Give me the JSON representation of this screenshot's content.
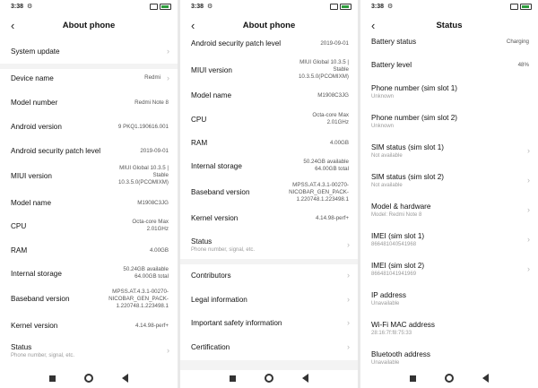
{
  "statusbar": {
    "time": "3:38",
    "gear": "⚙",
    "battery_color": "#2e9c3d"
  },
  "s1": {
    "title": "About phone",
    "items": [
      {
        "label": "System update",
        "value": "",
        "sub": ""
      },
      {
        "label": "Device name",
        "value": "Redmi",
        "sub": ""
      },
      {
        "label": "Model number",
        "value": "Redmi Note 8",
        "sub": ""
      },
      {
        "label": "Android version",
        "value": "9 PKQ1.190616.001",
        "sub": ""
      },
      {
        "label": "Android security patch level",
        "value": "2019-09-01",
        "sub": ""
      },
      {
        "label": "MIUI version",
        "value": "MIUI Global 10.3.5 |\nStable\n10.3.5.0(PCOMIXM)",
        "sub": ""
      },
      {
        "label": "Model name",
        "value": "M1908C3JG",
        "sub": ""
      },
      {
        "label": "CPU",
        "value": "Octa-core Max\n2.01GHz",
        "sub": ""
      },
      {
        "label": "RAM",
        "value": "4.00GB",
        "sub": ""
      },
      {
        "label": "Internal storage",
        "value": "50.24GB available\n64.00GB total",
        "sub": ""
      },
      {
        "label": "Baseband version",
        "value": "MPSS.AT.4.3.1-00270-\nNICOBAR_GEN_PACK-\n1.220748.1.223498.1",
        "sub": ""
      },
      {
        "label": "Kernel version",
        "value": "4.14.98-perf+",
        "sub": ""
      },
      {
        "label": "Status",
        "value": "",
        "sub": "Phone number, signal, etc."
      }
    ]
  },
  "s2": {
    "title": "About phone",
    "items": [
      {
        "label": "Android security patch level",
        "value": "2019-09-01",
        "sub": ""
      },
      {
        "label": "MIUI version",
        "value": "MIUI Global 10.3.5 |\nStable\n10.3.5.0(PCOMIXM)",
        "sub": ""
      },
      {
        "label": "Model name",
        "value": "M1908C3JG",
        "sub": ""
      },
      {
        "label": "CPU",
        "value": "Octa-core Max\n2.01GHz",
        "sub": ""
      },
      {
        "label": "RAM",
        "value": "4.00GB",
        "sub": ""
      },
      {
        "label": "Internal storage",
        "value": "50.24GB available\n64.00GB total",
        "sub": ""
      },
      {
        "label": "Baseband version",
        "value": "MPSS.AT.4.3.1-00270-\nNICOBAR_GEN_PACK-\n1.220748.1.223498.1",
        "sub": ""
      },
      {
        "label": "Kernel version",
        "value": "4.14.98-perf+",
        "sub": ""
      },
      {
        "label": "Status",
        "value": "",
        "sub": "Phone number, signal, etc."
      },
      {
        "label": "Contributors",
        "value": "",
        "sub": ""
      },
      {
        "label": "Legal information",
        "value": "",
        "sub": ""
      },
      {
        "label": "Important safety information",
        "value": "",
        "sub": ""
      },
      {
        "label": "Certification",
        "value": "",
        "sub": ""
      }
    ]
  },
  "s3": {
    "title": "Status",
    "items": [
      {
        "label": "Battery status",
        "value": "Charging",
        "sub": ""
      },
      {
        "label": "Battery level",
        "value": "48%",
        "sub": ""
      },
      {
        "label": "Phone number (sim slot 1)",
        "value": "",
        "sub": "Unknown"
      },
      {
        "label": "Phone number (sim slot 2)",
        "value": "",
        "sub": "Unknown"
      },
      {
        "label": "SIM status (sim slot 1)",
        "value": "",
        "sub": "Not available"
      },
      {
        "label": "SIM status (sim slot 2)",
        "value": "",
        "sub": "Not available"
      },
      {
        "label": "Model & hardware",
        "value": "",
        "sub": "Model: Redmi Note 8"
      },
      {
        "label": "IMEI (sim slot 1)",
        "value": "",
        "sub": "866481040541968"
      },
      {
        "label": "IMEI (sim slot 2)",
        "value": "",
        "sub": "866481041941969"
      },
      {
        "label": "IP address",
        "value": "",
        "sub": "Unavailable"
      },
      {
        "label": "Wi-Fi MAC address",
        "value": "",
        "sub": "28:16:7f:f8:75:33"
      },
      {
        "label": "Bluetooth address",
        "value": "",
        "sub": "Unavailable"
      }
    ]
  }
}
